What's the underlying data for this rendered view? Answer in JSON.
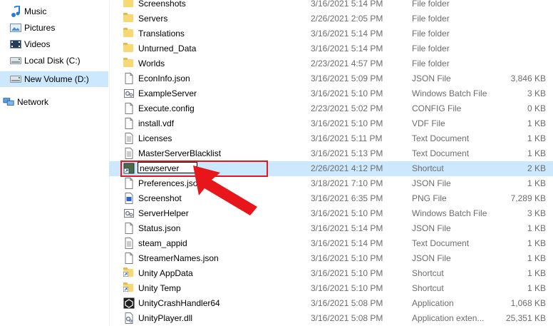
{
  "nav": {
    "items": [
      {
        "label": "Music",
        "icon": "music-icon"
      },
      {
        "label": "Pictures",
        "icon": "pictures-icon"
      },
      {
        "label": "Videos",
        "icon": "videos-icon"
      },
      {
        "label": "Local Disk (C:)",
        "icon": "drive-icon"
      },
      {
        "label": "New Volume (D:)",
        "icon": "drive-icon",
        "selected": true
      },
      {
        "label": "Network",
        "icon": "network-icon"
      }
    ]
  },
  "files": [
    {
      "name": "Screenshots",
      "date": "3/16/2021 5:14 PM",
      "type": "File folder",
      "size": "",
      "icon": "folder"
    },
    {
      "name": "Servers",
      "date": "2/26/2021 2:05 PM",
      "type": "File folder",
      "size": "",
      "icon": "folder"
    },
    {
      "name": "Translations",
      "date": "3/16/2021 5:14 PM",
      "type": "File folder",
      "size": "",
      "icon": "folder"
    },
    {
      "name": "Unturned_Data",
      "date": "3/16/2021 5:14 PM",
      "type": "File folder",
      "size": "",
      "icon": "folder"
    },
    {
      "name": "Worlds",
      "date": "2/23/2021 4:57 PM",
      "type": "File folder",
      "size": "",
      "icon": "folder"
    },
    {
      "name": "EconInfo.json",
      "date": "3/16/2021 5:09 PM",
      "type": "JSON File",
      "size": "3,846 KB",
      "icon": "doc"
    },
    {
      "name": "ExampleServer",
      "date": "3/16/2021 5:10 PM",
      "type": "Windows Batch File",
      "size": "3 KB",
      "icon": "batch"
    },
    {
      "name": "Execute.config",
      "date": "2/23/2021 5:02 PM",
      "type": "CONFIG File",
      "size": "0 KB",
      "icon": "doc"
    },
    {
      "name": "install.vdf",
      "date": "3/16/2021 5:10 PM",
      "type": "VDF File",
      "size": "1 KB",
      "icon": "doc"
    },
    {
      "name": "Licenses",
      "date": "3/16/2021 5:11 PM",
      "type": "Text Document",
      "size": "1 KB",
      "icon": "text"
    },
    {
      "name": "MasterServerBlacklist",
      "date": "3/16/2021 5:13 PM",
      "type": "Text Document",
      "size": "1 KB",
      "icon": "text"
    },
    {
      "name": "newserver",
      "date": "2/26/2021 4:12 PM",
      "type": "Shortcut",
      "size": "2 KB",
      "icon": "shortcut",
      "renaming": true
    },
    {
      "name": "Preferences.json",
      "date": "3/18/2021 7:10 PM",
      "type": "JSON File",
      "size": "1 KB",
      "icon": "doc"
    },
    {
      "name": "Screenshot",
      "date": "3/16/2021 6:35 PM",
      "type": "PNG File",
      "size": "7,289 KB",
      "icon": "png"
    },
    {
      "name": "ServerHelper",
      "date": "3/16/2021 5:10 PM",
      "type": "Windows Batch File",
      "size": "3 KB",
      "icon": "batch"
    },
    {
      "name": "Status.json",
      "date": "3/16/2021 5:14 PM",
      "type": "JSON File",
      "size": "1 KB",
      "icon": "doc"
    },
    {
      "name": "steam_appid",
      "date": "3/16/2021 5:14 PM",
      "type": "Text Document",
      "size": "1 KB",
      "icon": "text"
    },
    {
      "name": "StreamerNames.json",
      "date": "3/16/2021 5:10 PM",
      "type": "JSON File",
      "size": "1 KB",
      "icon": "doc"
    },
    {
      "name": "Unity AppData",
      "date": "3/16/2021 5:10 PM",
      "type": "Shortcut",
      "size": "1 KB",
      "icon": "folder-shortcut"
    },
    {
      "name": "Unity Temp",
      "date": "3/16/2021 5:10 PM",
      "type": "Shortcut",
      "size": "1 KB",
      "icon": "folder-shortcut"
    },
    {
      "name": "UnityCrashHandler64",
      "date": "3/16/2021 5:08 PM",
      "type": "Application",
      "size": "1,068 KB",
      "icon": "app"
    },
    {
      "name": "UnityPlayer.dll",
      "date": "3/16/2021 5:08 PM",
      "type": "Application exten...",
      "size": "25,351 KB",
      "icon": "dll"
    }
  ],
  "rename_value": "newserver",
  "colors": {
    "selection": "#cce8ff",
    "highlight": "#e8161a",
    "arrow": "#e8161a"
  }
}
